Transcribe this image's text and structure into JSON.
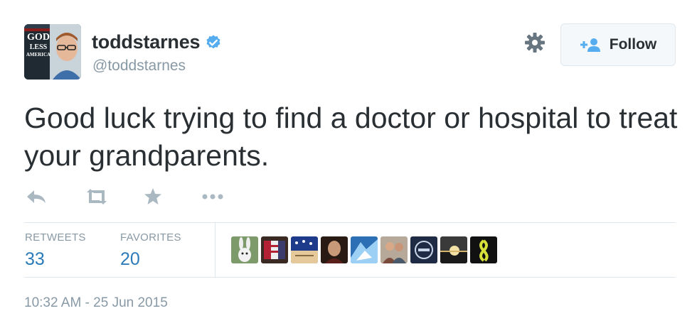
{
  "user": {
    "name": "toddstarnes",
    "handle": "@toddstarnes",
    "verified": true,
    "avatar_icon": "profile-photo-with-book-cover",
    "book_cover_text": [
      "GOD",
      "LESS",
      "AMERICA"
    ]
  },
  "controls": {
    "settings_icon": "gear-icon",
    "follow_icon": "add-user-icon",
    "follow_label": "Follow"
  },
  "tweet": {
    "text": "Good luck trying to find a doctor or hospital to treat your grandparents."
  },
  "actions": [
    {
      "icon": "reply-icon"
    },
    {
      "icon": "retweet-icon"
    },
    {
      "icon": "favorite-icon"
    },
    {
      "icon": "more-icon"
    }
  ],
  "stats": {
    "retweets_label": "RETWEETS",
    "retweets_count": "33",
    "favorites_label": "FAVORITES",
    "favorites_count": "20"
  },
  "favoriters": [
    {
      "icon": "user-avatar-rabbit"
    },
    {
      "icon": "user-avatar-flag"
    },
    {
      "icon": "user-avatar-constitution"
    },
    {
      "icon": "user-avatar-portrait"
    },
    {
      "icon": "user-avatar-blue-graphic"
    },
    {
      "icon": "user-avatar-couple"
    },
    {
      "icon": "user-avatar-logo"
    },
    {
      "icon": "user-avatar-sunset"
    },
    {
      "icon": "user-avatar-ribbon"
    }
  ],
  "timestamp": "10:32 AM - 25 Jun 2015",
  "colors": {
    "text": "#292f33",
    "muted": "#8899a6",
    "link_blue": "#2b7bb9",
    "verified_blue": "#55acee",
    "border": "#e1e8ed",
    "icon_gray": "#aab8c2"
  }
}
